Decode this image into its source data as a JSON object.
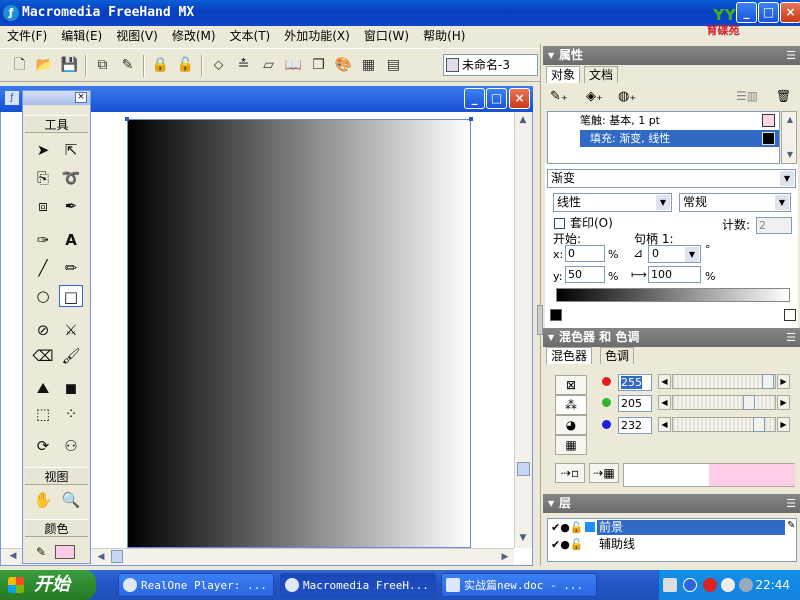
{
  "app": {
    "title": "Macromedia FreeHand MX",
    "logo_text": "育碟苑",
    "window_controls": {
      "minimize": "_",
      "maximize": "□",
      "close": "×"
    }
  },
  "menu": [
    "文件(F)",
    "编辑(E)",
    "视图(V)",
    "修改(M)",
    "文本(T)",
    "外加功能(X)",
    "窗口(W)",
    "帮助(H)"
  ],
  "toolbar": {
    "document_select": "未命名-3",
    "buttons": [
      "new-file",
      "open-folder",
      "save",
      "import",
      "export",
      "lock",
      "unlock",
      "group",
      "align",
      "transform",
      "library",
      "objects",
      "swatches",
      "table",
      "layers"
    ]
  },
  "tools_panel": {
    "title_close": "×",
    "section_tools": "工具",
    "section_view": "视图",
    "section_color": "颜色"
  },
  "properties_panel": {
    "title": "属性",
    "menu_icon": "☰",
    "tabs": [
      "对象",
      "文档"
    ],
    "attributes": [
      {
        "label": "笔触: 基本, 1 pt",
        "swatch": "#ffd4e5"
      },
      {
        "label": "填充: 渐变, 线性",
        "swatch": "#000000"
      }
    ],
    "fill_type": "渐变",
    "gradient_type": "线性",
    "gradient_mode": "常规",
    "overprint_label": "套印(O)",
    "steps_label": "计数:",
    "steps_value": "2",
    "start_label": "开始:",
    "handle_label": "句柄 1:",
    "x_label": "x:",
    "x_value": "0",
    "y_label": "y:",
    "y_value": "50",
    "percent": "%",
    "angle_value": "0",
    "degree": "°",
    "length_value": "100"
  },
  "mixer_panel": {
    "title": "混色器 和 色调",
    "tabs": [
      "混色器",
      "色调"
    ],
    "r_value": "255",
    "g_value": "205",
    "b_value": "232",
    "colors": {
      "r": "#e41b1b",
      "g": "#2db52d",
      "b": "#1b1be4",
      "preview": "#ffcde8"
    }
  },
  "layers_panel": {
    "title": "层",
    "layers": [
      {
        "name": "前景",
        "color": "#1f8fff"
      },
      {
        "name": "辅助线",
        "color": ""
      }
    ]
  },
  "taskbar": {
    "start_label": "开始",
    "tasks": [
      "RealOne Player: ...",
      "Macromedia FreeH...",
      "实战篇new.doc - ..."
    ],
    "clock": "22:44"
  }
}
